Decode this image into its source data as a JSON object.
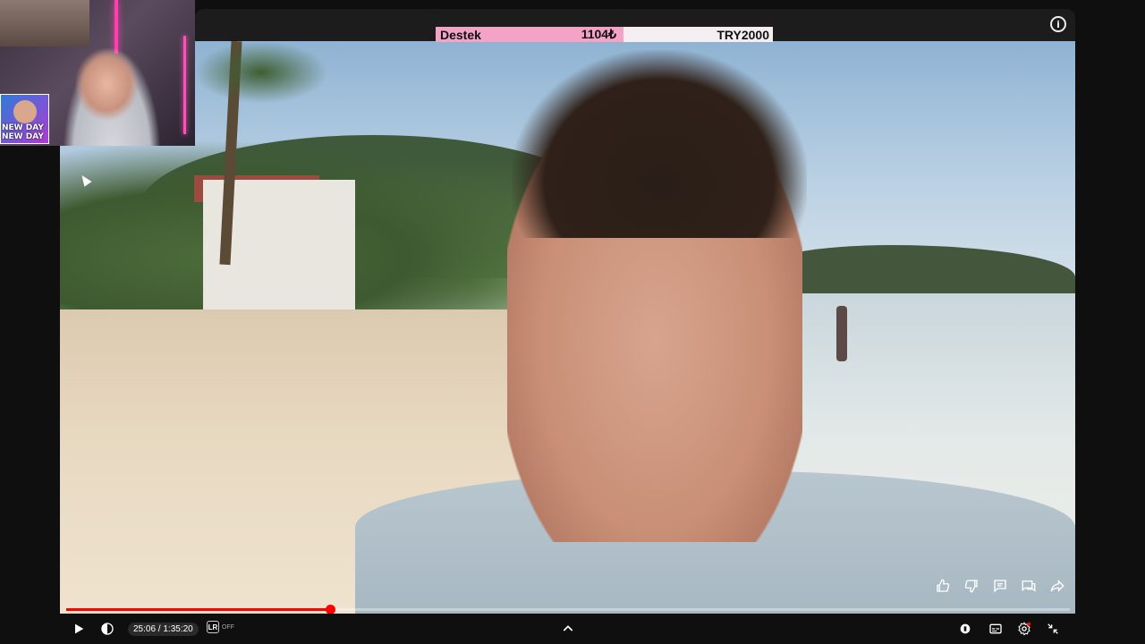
{
  "banner": {
    "label": "Destek",
    "amount": "1104₺",
    "goal": "TRY2000"
  },
  "webcam": {
    "avatar_text_line1": "NEW DAY",
    "avatar_text_line2": "NEW DAY"
  },
  "player": {
    "time_current": "25:06",
    "time_total": "1:35:20",
    "time_display": "25:06 / 1:35:20",
    "progress_fraction": 0.263,
    "autotranslate_badge": "LR",
    "autotranslate_state": "OFF",
    "accent_color": "#ff0000"
  },
  "actions": {
    "icons": [
      "thumbs-up-icon",
      "thumbs-down-icon",
      "comment-icon",
      "chat-icon",
      "share-icon"
    ]
  },
  "controls": {
    "icons": [
      "play-icon",
      "volume-icon",
      "chevron-up-icon",
      "autoplay-icon",
      "subtitles-icon",
      "settings-icon",
      "exit-fullscreen-icon"
    ]
  }
}
